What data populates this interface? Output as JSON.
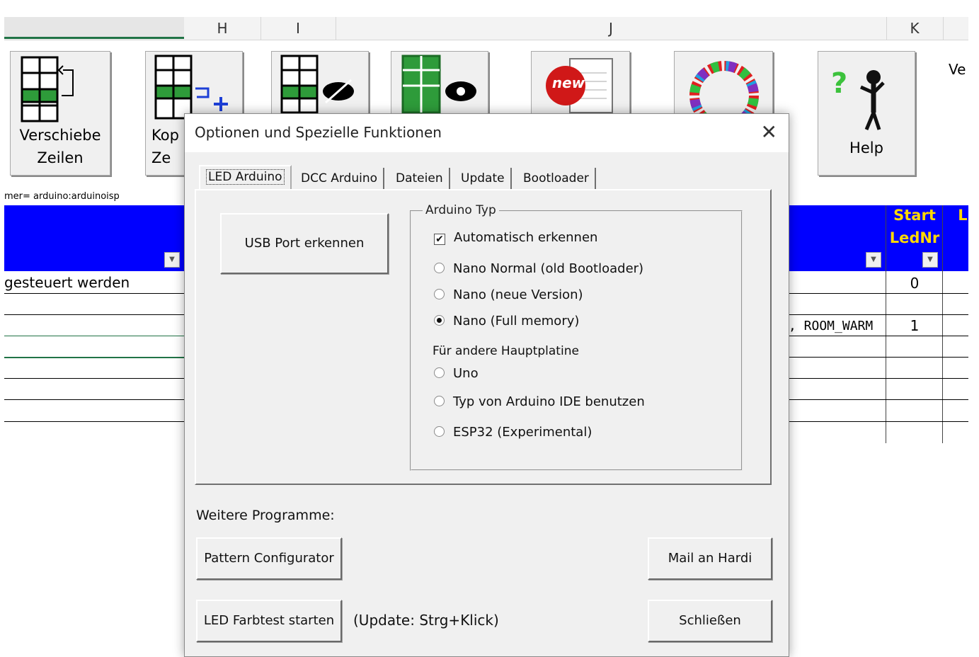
{
  "excel": {
    "columns": [
      "H",
      "I",
      "J",
      "K"
    ],
    "ribbon_buttons": [
      {
        "label_line1": "Verschiebe",
        "label_line2": "Zeilen"
      },
      {
        "label_line1": "Kop",
        "label_line2": "Ze"
      },
      {
        "label_line1": "",
        "label_line2": ""
      },
      {
        "label_line1": "",
        "label_line2": ""
      },
      {
        "label_line1": "",
        "label_line2": ""
      },
      {
        "label_line1": "",
        "label_line2": ""
      },
      {
        "label_line1": "Help",
        "label_line2": ""
      }
    ],
    "new_badge": "new",
    "version_text": "Ve",
    "formula_text": "mer= arduino:arduinoisp",
    "header_start": "Start",
    "header_lednr": "LedNr",
    "header_l": "L",
    "row1_text": "gesteuert werden",
    "row1_value": "0",
    "row3_text": ", ROOM_WARM",
    "row3_value": "1"
  },
  "dialog": {
    "title": "Optionen und Spezielle Funktionen",
    "close_symbol": "✕",
    "tabs": [
      "LED Arduino",
      "DCC Arduino",
      "Dateien",
      "Update",
      "Bootloader"
    ],
    "active_tab": "LED Arduino",
    "usb_button": "USB Port erkennen",
    "group_label": "Arduino Typ",
    "auto_checkbox": {
      "label": "Automatisch erkennen",
      "checked": true
    },
    "radio_options": [
      {
        "label": "Nano Normal (old Bootloader)",
        "selected": false
      },
      {
        "label": "Nano (neue Version)",
        "selected": false
      },
      {
        "label": "Nano (Full memory)",
        "selected": true
      }
    ],
    "other_board_label": "Für andere Hauptplatine",
    "other_options": [
      {
        "label": "Uno",
        "selected": false
      },
      {
        "label": "Typ von Arduino IDE benutzen",
        "selected": false
      },
      {
        "label": "ESP32 (Experimental)",
        "selected": false
      }
    ],
    "further_programs_label": "Weitere Programme:",
    "pattern_button": "Pattern Configurator",
    "mail_button": "Mail an Hardi",
    "led_test_button": "LED Farbtest starten",
    "update_hint": "(Update: Strg+Klick)",
    "close_button": "Schließen"
  },
  "colors": {
    "blue_header": "#0000ff",
    "yellow_text": "#ffd800",
    "excel_green": "#217346"
  }
}
